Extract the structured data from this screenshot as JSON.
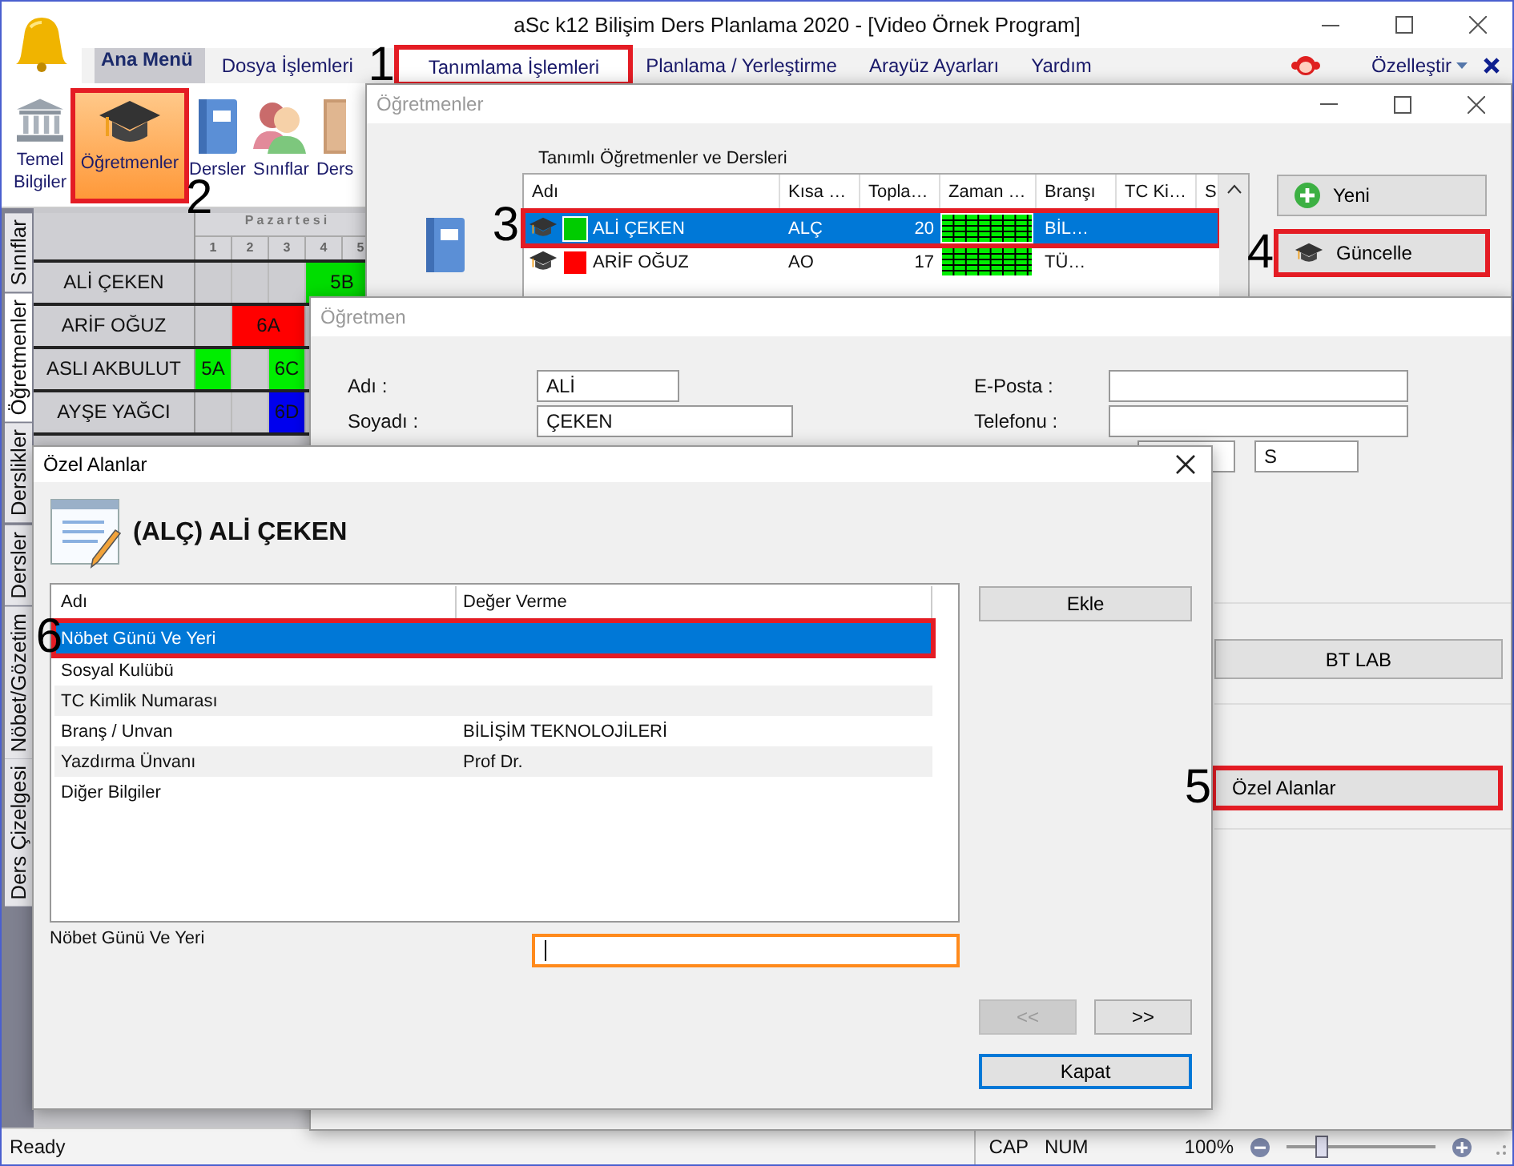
{
  "window": {
    "title": "aSc k12 Bilişim Ders Planlama 2020  - [Video Örnek Program]"
  },
  "menu": {
    "items": [
      {
        "label": "Ana Menü",
        "kind": "main",
        "selected": false,
        "highlighted": false
      },
      {
        "label": "Dosya İşlemleri",
        "kind": "tab",
        "selected": false,
        "highlighted": false
      },
      {
        "label": "Tanımlama İşlemleri",
        "kind": "tab",
        "selected": true,
        "highlighted": true,
        "callout": "1"
      },
      {
        "label": "Planlama / Yerleştirme",
        "kind": "tab",
        "selected": false,
        "highlighted": false
      },
      {
        "label": "Arayüz Ayarları",
        "kind": "tab",
        "selected": false,
        "highlighted": false
      },
      {
        "label": "Yardım",
        "kind": "tab",
        "selected": false,
        "highlighted": false
      }
    ],
    "customize": "Özelleştir"
  },
  "ribbon": [
    {
      "label": "Temel Bilgiler",
      "selected": false,
      "highlighted": false
    },
    {
      "label": "Öğretmenler",
      "selected": true,
      "highlighted": true,
      "callout": "2"
    },
    {
      "label": "Dersler",
      "selected": false,
      "highlighted": false
    },
    {
      "label": "Sınıflar",
      "selected": false,
      "highlighted": false
    },
    {
      "label": "Ders",
      "selected": false,
      "highlighted": false
    }
  ],
  "side_tabs": [
    {
      "label": "Sınıflar",
      "selected": false
    },
    {
      "label": "Öğretmenler",
      "selected": true
    },
    {
      "label": "Derslikler",
      "selected": false
    },
    {
      "label": "Dersler",
      "selected": false
    },
    {
      "label": "Nöbet/Gözetim",
      "selected": false
    },
    {
      "label": "Ders Çizelgesi",
      "selected": false
    }
  ],
  "timetable": {
    "day": "Pazartesi",
    "periods": [
      "1",
      "2",
      "3",
      "4",
      "5"
    ],
    "rows": [
      {
        "name": "ALİ ÇEKEN",
        "cells": [
          {
            "kind": "empty"
          },
          {
            "kind": "empty"
          },
          {
            "kind": "empty"
          },
          {
            "kind": "lesson",
            "label": "5B",
            "color": "#00dd00",
            "wide": true
          }
        ]
      },
      {
        "name": "ARİF OĞUZ",
        "cells": [
          {
            "kind": "empty"
          },
          {
            "kind": "lesson",
            "label": "6A",
            "color": "#ff0000",
            "wide": true
          },
          {
            "kind": "empty"
          }
        ]
      },
      {
        "name": "ASLI AKBULUT",
        "cells": [
          {
            "kind": "lesson",
            "label": "5A",
            "color": "#00ee00",
            "wide": false
          },
          {
            "kind": "empty"
          },
          {
            "kind": "lesson",
            "label": "6C",
            "color": "#00ee00",
            "wide": false
          }
        ]
      },
      {
        "name": "AYŞE YAĞCI",
        "cells": [
          {
            "kind": "empty"
          },
          {
            "kind": "empty"
          },
          {
            "kind": "lesson",
            "label": "6D",
            "color": "#0000ee",
            "wide": false
          },
          {
            "kind": "empty"
          }
        ]
      }
    ]
  },
  "teachers_window": {
    "title": "Öğretmenler",
    "list_title": "Tanımlı Öğretmenler ve Dersleri",
    "columns": [
      "Adı",
      "Kısa …",
      "Topla…",
      "Zaman …",
      "Branşı",
      "TC Ki…",
      "S"
    ],
    "rows": [
      {
        "name": "ALİ ÇEKEN",
        "color": "#00cc00",
        "short": "ALÇ",
        "total": "20",
        "branch": "BİL…",
        "selected": true,
        "highlighted": true,
        "callout": "3"
      },
      {
        "name": "ARİF OĞUZ",
        "color": "#ff0000",
        "short": "AO",
        "total": "17",
        "branch": "TÜ…",
        "selected": false,
        "highlighted": false
      }
    ],
    "buttons": [
      {
        "label": "Yeni",
        "highlighted": false
      },
      {
        "label": "Güncelle",
        "highlighted": true,
        "callout": "4"
      }
    ]
  },
  "teacher_window": {
    "title": "Öğretmen",
    "fields": [
      {
        "label": "Adı :",
        "value": "ALİ"
      },
      {
        "label": "E-Posta :"
      },
      {
        "label": "Soyadı :",
        "value": "ÇEKEN"
      },
      {
        "label": "Telefonu :"
      }
    ],
    "extra_value": "S",
    "buttons": [
      {
        "label": "BT LAB",
        "highlighted": false
      },
      {
        "label": "Özel Alanlar",
        "highlighted": true,
        "callout": "5"
      }
    ]
  },
  "custom_fields_dialog": {
    "title": "Özel Alanlar",
    "heading": "(ALÇ) ALİ ÇEKEN",
    "columns": [
      "Adı",
      "Değer Verme"
    ],
    "rows": [
      {
        "name": "Nöbet Günü Ve Yeri",
        "selected": true,
        "highlighted": true,
        "callout": "6"
      },
      {
        "name": "Sosyal Kulübü",
        "selected": false,
        "highlighted": false
      },
      {
        "name": "TC Kimlik Numarası",
        "selected": false,
        "highlighted": false
      },
      {
        "name": "Branş / Unvan",
        "value": "BİLİŞİM TEKNOLOJİLERİ",
        "selected": false,
        "highlighted": false
      },
      {
        "name": "Yazdırma Ünvanı",
        "value": "Prof Dr.",
        "selected": false,
        "highlighted": false
      },
      {
        "name": "Diğer Bilgiler",
        "selected": false,
        "highlighted": false
      }
    ],
    "edit_label": "Nöbet Günü Ve Yeri",
    "edit": {
      "focused": true
    },
    "buttons": [
      {
        "label": "Ekle",
        "kind": "add",
        "disabled": false,
        "default": false
      },
      {
        "label": "<<",
        "kind": "prev",
        "disabled": true,
        "default": false
      },
      {
        "label": ">>",
        "kind": "next",
        "disabled": false,
        "default": false
      },
      {
        "label": "Kapat",
        "kind": "close",
        "disabled": false,
        "default": true
      }
    ]
  },
  "status_bar": {
    "text": "Ready",
    "indicators": [
      "CAP",
      "NUM"
    ],
    "zoom": "100%",
    "zoom_slider": {
      "level": 0.24
    }
  }
}
